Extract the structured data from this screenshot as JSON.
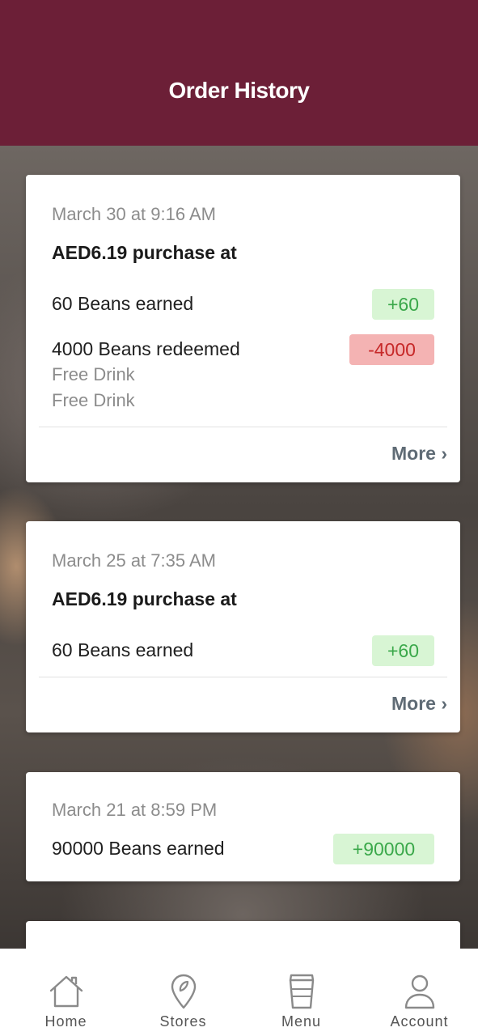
{
  "header": {
    "title": "Order History"
  },
  "orders": [
    {
      "date": "March 30 at 9:16 AM",
      "purchase": "AED6.19 purchase at",
      "earned": {
        "text": "60 Beans earned",
        "badge": "+60"
      },
      "redeemed": {
        "text": "4000 Beans redeemed",
        "badge": "-4000",
        "items": [
          "Free Drink",
          "Free Drink"
        ]
      },
      "more_label": "More ›"
    },
    {
      "date": "March 25 at 7:35 AM",
      "purchase": "AED6.19 purchase at",
      "earned": {
        "text": "60 Beans earned",
        "badge": "+60"
      },
      "more_label": "More ›"
    },
    {
      "date": "March 21 at 8:59 PM",
      "earned": {
        "text": "90000 Beans earned",
        "badge": "+90000"
      }
    }
  ],
  "tabbar": {
    "items": [
      {
        "label": "Home",
        "icon": "home-icon"
      },
      {
        "label": "Stores",
        "icon": "location-pin-icon"
      },
      {
        "label": "Menu",
        "icon": "cup-icon"
      },
      {
        "label": "Account",
        "icon": "person-icon"
      }
    ]
  },
  "colors": {
    "header": "#6c1f37",
    "positive_badge_bg": "#d8f5d4",
    "positive_badge_text": "#3aa84a",
    "negative_badge_bg": "#f4b3b3",
    "negative_badge_text": "#c62828"
  }
}
